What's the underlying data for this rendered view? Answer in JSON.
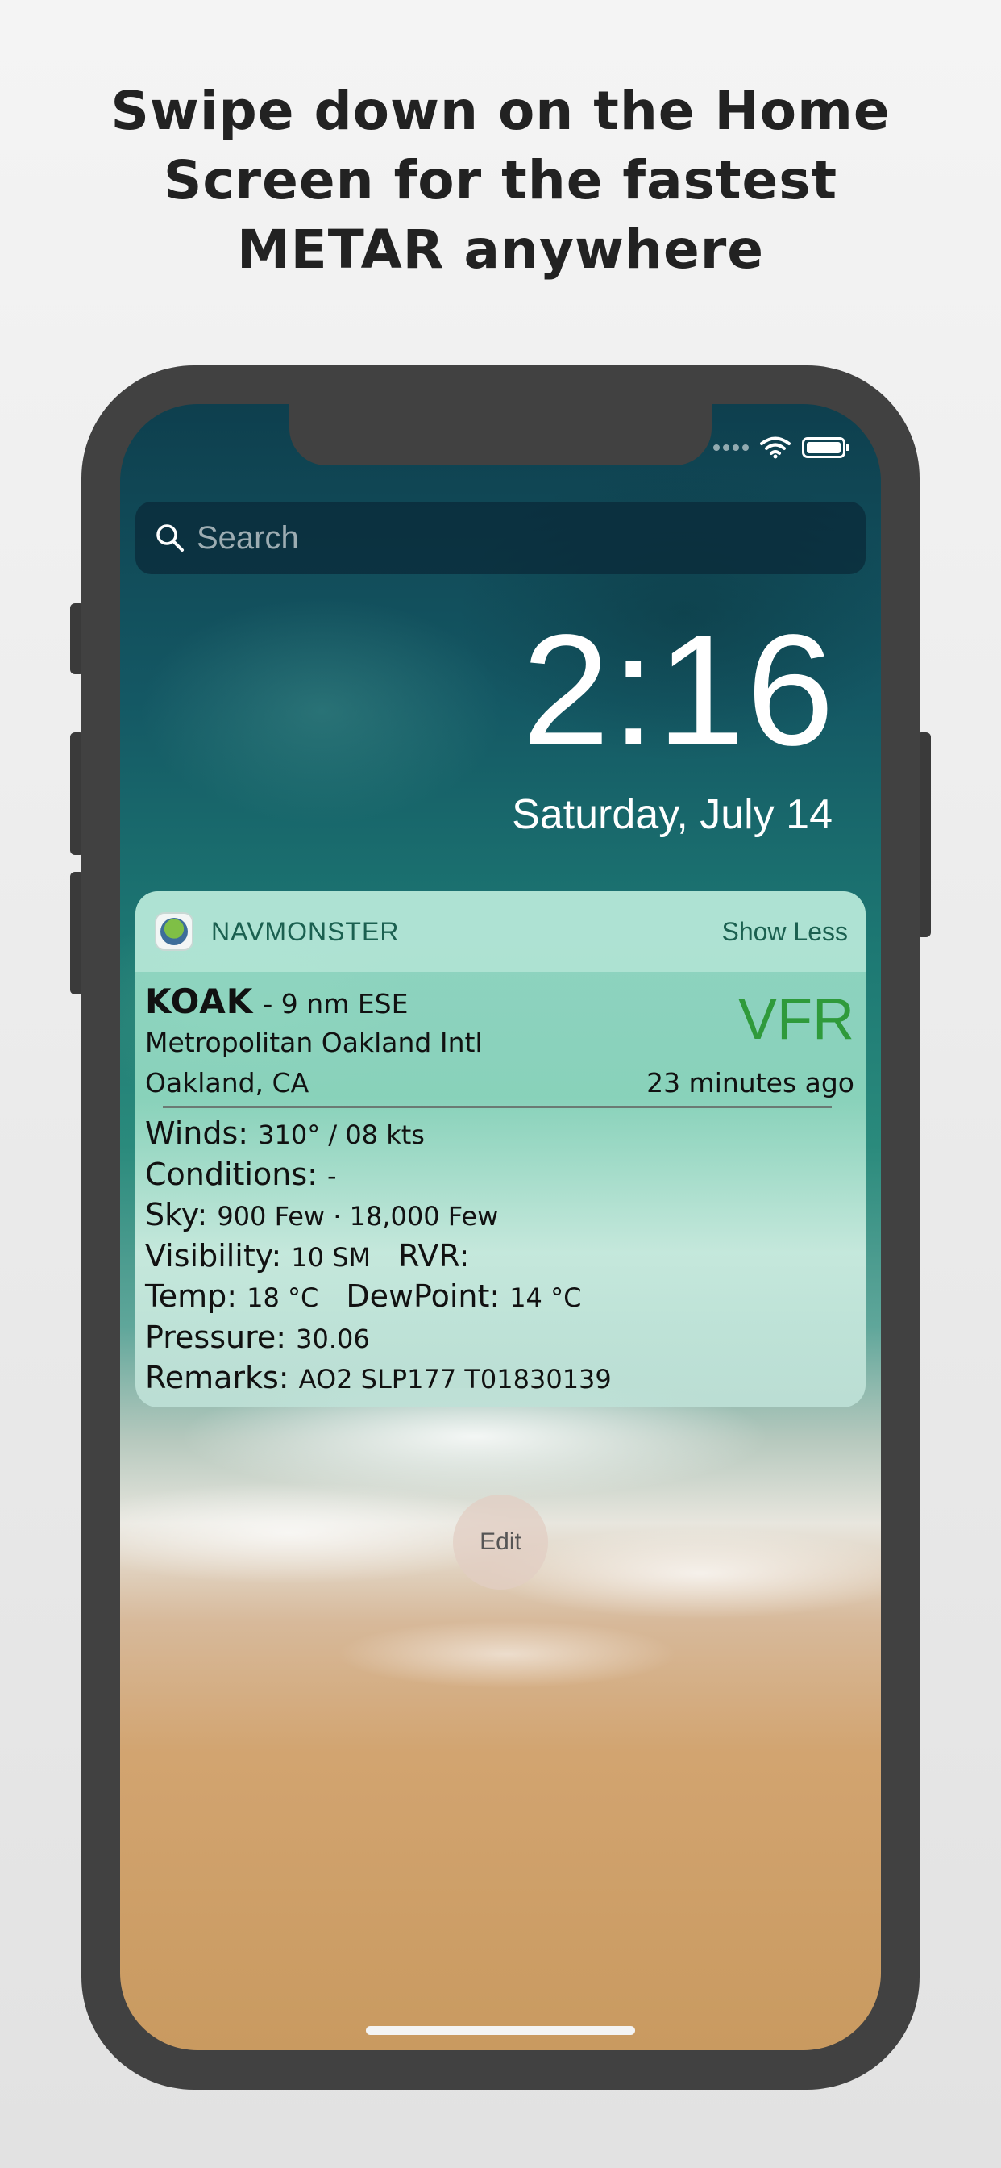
{
  "headline": {
    "line1": "Swipe down on the Home",
    "line2": "Screen for the fastest",
    "line3": "METAR anywhere"
  },
  "lock_screen": {
    "search_placeholder": "Search",
    "time": "2:16",
    "date": "Saturday, July 14",
    "edit_label": "Edit"
  },
  "widget": {
    "app_name": "NAVMONSTER",
    "toggle_label": "Show Less",
    "station_id": "KOAK",
    "station_distance": "- 9 nm ESE",
    "flight_category": "VFR",
    "flight_category_color": "#2f9a3b",
    "airport_name": "Metropolitan Oakland Intl",
    "city": "Oakland, CA",
    "observation_age": "23 minutes ago",
    "winds_label": "Winds:",
    "winds_value": "310° / 08 kts",
    "conditions_label": "Conditions:",
    "conditions_value": "-",
    "sky_label": "Sky:",
    "sky_value": "900 Few · 18,000 Few",
    "visibility_label": "Visibility:",
    "visibility_value": "10 SM",
    "rvr_label": "RVR:",
    "rvr_value": "",
    "temp_label": "Temp:",
    "temp_value": "18 °C",
    "dewpoint_label": "DewPoint:",
    "dewpoint_value": "14 °C",
    "pressure_label": "Pressure:",
    "pressure_value": "30.06",
    "remarks_label": "Remarks:",
    "remarks_value": "AO2 SLP177 T01830139"
  }
}
